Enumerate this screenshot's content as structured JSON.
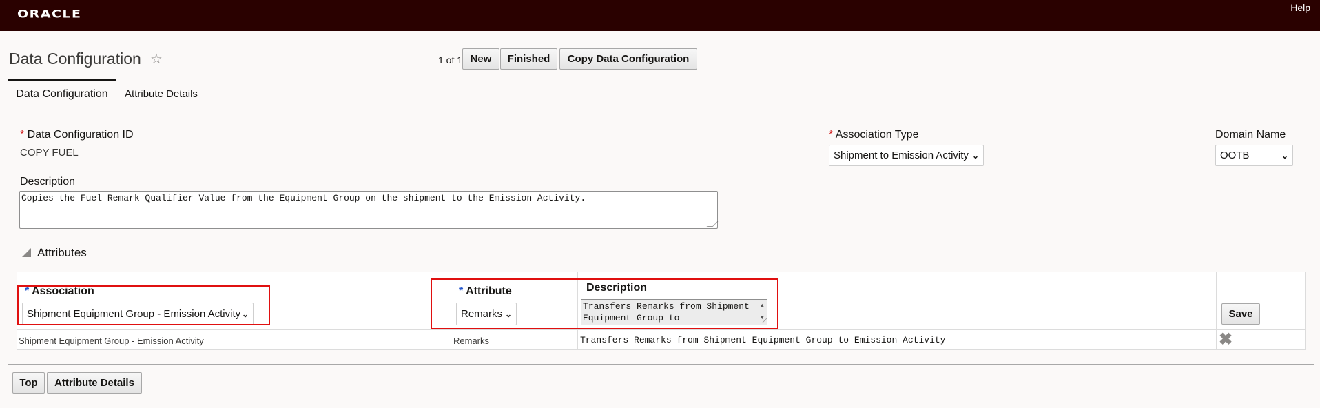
{
  "header": {
    "brand": "ORACLE",
    "help": "Help"
  },
  "page": {
    "title": "Data Configuration",
    "pager": "1 of 1"
  },
  "toolbar": {
    "new": "New",
    "finished": "Finished",
    "copy": "Copy Data Configuration"
  },
  "tabs": [
    {
      "label": "Data Configuration",
      "active": true
    },
    {
      "label": "Attribute Details",
      "active": false
    }
  ],
  "form": {
    "id_label": "Data Configuration ID",
    "id_value": "COPY FUEL",
    "assoc_type_label": "Association Type",
    "assoc_type_value": "Shipment to Emission Activity",
    "domain_label": "Domain Name",
    "domain_value": "OOTB",
    "description_label": "Description",
    "description_value": "Copies the Fuel Remark Qualifier Value from the Equipment Group on the shipment to the Emission Activity."
  },
  "attributes": {
    "section_title": "Attributes",
    "header": {
      "association_label": "Association",
      "association_value": "Shipment Equipment Group - Emission Activity",
      "attribute_label": "Attribute",
      "attribute_value": "Remarks",
      "description_label": "Description",
      "description_value": "Transfers Remarks from Shipment Equipment Group to",
      "save": "Save"
    },
    "rows": [
      {
        "association": "Shipment Equipment Group - Emission Activity",
        "attribute": "Remarks",
        "description": "Transfers Remarks from Shipment Equipment Group to Emission Activity"
      }
    ]
  },
  "footer": {
    "top": "Top",
    "attribute_details": "Attribute Details"
  },
  "colors": {
    "header_bg": "#2a0100",
    "highlight": "#e01010",
    "required": "#cc0000"
  }
}
